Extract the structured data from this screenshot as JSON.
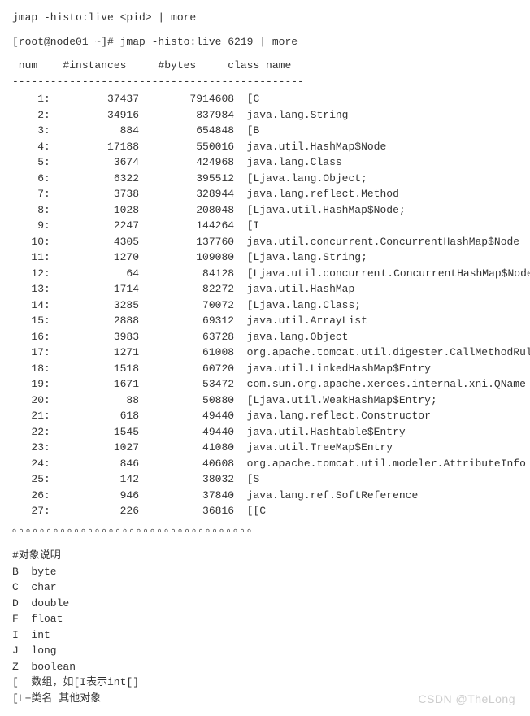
{
  "cmd_template": "jmap -histo:live <pid> | more",
  "shell_prompt": "[root@node01 ~]# ",
  "shell_command": "jmap -histo:live 6219 | more",
  "header": {
    "num": "num",
    "instances": "#instances",
    "bytes": "#bytes",
    "classname": "class name"
  },
  "divider": "----------------------------------------------",
  "rows": [
    {
      "num": "1:",
      "instances": "37437",
      "bytes": "7914608",
      "classname": "[C"
    },
    {
      "num": "2:",
      "instances": "34916",
      "bytes": "837984",
      "classname": "java.lang.String"
    },
    {
      "num": "3:",
      "instances": "884",
      "bytes": "654848",
      "classname": "[B"
    },
    {
      "num": "4:",
      "instances": "17188",
      "bytes": "550016",
      "classname": "java.util.HashMap$Node"
    },
    {
      "num": "5:",
      "instances": "3674",
      "bytes": "424968",
      "classname": "java.lang.Class"
    },
    {
      "num": "6:",
      "instances": "6322",
      "bytes": "395512",
      "classname": "[Ljava.lang.Object;"
    },
    {
      "num": "7:",
      "instances": "3738",
      "bytes": "328944",
      "classname": "java.lang.reflect.Method"
    },
    {
      "num": "8:",
      "instances": "1028",
      "bytes": "208048",
      "classname": "[Ljava.util.HashMap$Node;"
    },
    {
      "num": "9:",
      "instances": "2247",
      "bytes": "144264",
      "classname": "[I"
    },
    {
      "num": "10:",
      "instances": "4305",
      "bytes": "137760",
      "classname": "java.util.concurrent.ConcurrentHashMap$Node"
    },
    {
      "num": "11:",
      "instances": "1270",
      "bytes": "109080",
      "classname": "[Ljava.lang.String;"
    },
    {
      "num": "12:",
      "instances": "64",
      "bytes": "84128",
      "classname": "[Ljava.util.concurrent.ConcurrentHashMap$Node;",
      "cursor": true
    },
    {
      "num": "13:",
      "instances": "1714",
      "bytes": "82272",
      "classname": "java.util.HashMap"
    },
    {
      "num": "14:",
      "instances": "3285",
      "bytes": "70072",
      "classname": "[Ljava.lang.Class;"
    },
    {
      "num": "15:",
      "instances": "2888",
      "bytes": "69312",
      "classname": "java.util.ArrayList"
    },
    {
      "num": "16:",
      "instances": "3983",
      "bytes": "63728",
      "classname": "java.lang.Object"
    },
    {
      "num": "17:",
      "instances": "1271",
      "bytes": "61008",
      "classname": "org.apache.tomcat.util.digester.CallMethodRule"
    },
    {
      "num": "18:",
      "instances": "1518",
      "bytes": "60720",
      "classname": "java.util.LinkedHashMap$Entry"
    },
    {
      "num": "19:",
      "instances": "1671",
      "bytes": "53472",
      "classname": "com.sun.org.apache.xerces.internal.xni.QName"
    },
    {
      "num": "20:",
      "instances": "88",
      "bytes": "50880",
      "classname": "[Ljava.util.WeakHashMap$Entry;"
    },
    {
      "num": "21:",
      "instances": "618",
      "bytes": "49440",
      "classname": "java.lang.reflect.Constructor"
    },
    {
      "num": "22:",
      "instances": "1545",
      "bytes": "49440",
      "classname": "java.util.Hashtable$Entry"
    },
    {
      "num": "23:",
      "instances": "1027",
      "bytes": "41080",
      "classname": "java.util.TreeMap$Entry"
    },
    {
      "num": "24:",
      "instances": "846",
      "bytes": "40608",
      "classname": "org.apache.tomcat.util.modeler.AttributeInfo"
    },
    {
      "num": "25:",
      "instances": "142",
      "bytes": "38032",
      "classname": "[S"
    },
    {
      "num": "26:",
      "instances": "946",
      "bytes": "37840",
      "classname": "java.lang.ref.SoftReference"
    },
    {
      "num": "27:",
      "instances": "226",
      "bytes": "36816",
      "classname": "[[C"
    }
  ],
  "dots": "。。。。。。。。。。。。。。。。。。。。。。。。。。。。。。。。。。。",
  "explain_title": "#对象说明",
  "explain": [
    {
      "k": "B",
      "v": "byte"
    },
    {
      "k": "C",
      "v": "char"
    },
    {
      "k": "D",
      "v": "double"
    },
    {
      "k": "F",
      "v": "float"
    },
    {
      "k": "I",
      "v": "int"
    },
    {
      "k": "J",
      "v": "long"
    },
    {
      "k": "Z",
      "v": "boolean"
    }
  ],
  "explain_array": "[  数组，如[I表示int[]",
  "explain_other": "[L+类名 其他对象",
  "watermark": "CSDN @TheLong"
}
